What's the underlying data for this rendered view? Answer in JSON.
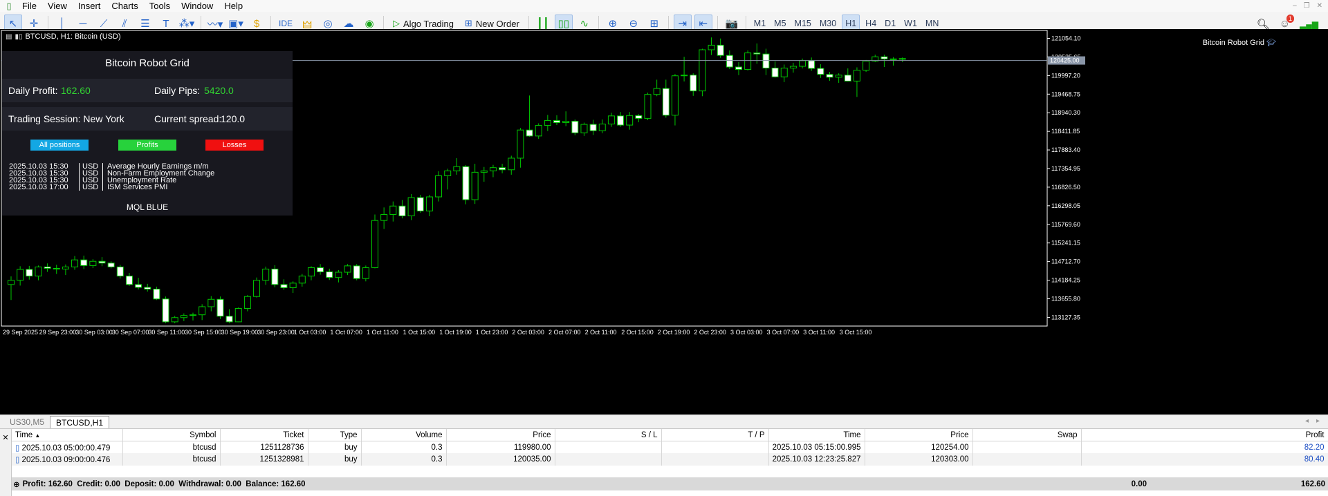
{
  "menu": [
    "File",
    "View",
    "Insert",
    "Charts",
    "Tools",
    "Window",
    "Help"
  ],
  "toolbar": {
    "ide": "IDE",
    "algo_trading": "Algo Trading",
    "new_order": "New Order",
    "timeframes": [
      "M1",
      "M5",
      "M15",
      "M30",
      "H1",
      "H4",
      "D1",
      "W1",
      "MN"
    ],
    "active_timeframe": "H1",
    "notifications_count": "1"
  },
  "chart": {
    "title": "BTCUSD, H1:  Bitcoin (USD)",
    "indicator_name": "Bitcoin Robot Grid",
    "price_tag": "120425.00",
    "colors": {
      "background": "#000000",
      "bull_candle": "#000000",
      "bear_candle": "#ffffff",
      "wick": "#00c800",
      "grid_text": "#ffffff"
    }
  },
  "panel": {
    "title": "Bitcoin Robot Grid",
    "daily_profit_label": "Daily Profit:",
    "daily_profit_value": "162.60",
    "daily_pips_label": "Daily Pips:",
    "daily_pips_value": "5420.0",
    "session_label": "Trading Session: New York",
    "spread_label": "Current spread:",
    "spread_value": "120.0",
    "buttons": {
      "all": "All positions",
      "profits": "Profits",
      "losses": "Losses"
    },
    "news": [
      {
        "time": "2025.10.03 15:30",
        "currency": "USD",
        "event": "Average Hourly Earnings m/m"
      },
      {
        "time": "2025.10.03 15:30",
        "currency": "USD",
        "event": "Non-Farm Employment Change"
      },
      {
        "time": "2025.10.03 15:30",
        "currency": "USD",
        "event": "Unemployment Rate"
      },
      {
        "time": "2025.10.03 17:00",
        "currency": "USD",
        "event": "ISM Services PMI"
      }
    ],
    "brand": "MQL BLUE"
  },
  "chart_data": {
    "type": "candlestick",
    "symbol": "BTCUSD",
    "timeframe": "H1",
    "x_tick_labels": [
      "29 Sep 2025",
      "29 Sep 23:00",
      "30 Sep 03:00",
      "30 Sep 07:00",
      "30 Sep 11:00",
      "30 Sep 15:00",
      "30 Sep 19:00",
      "30 Sep 23:00",
      "1 Oct 03:00",
      "1 Oct 07:00",
      "1 Oct 11:00",
      "1 Oct 15:00",
      "1 Oct 19:00",
      "1 Oct 23:00",
      "2 Oct 03:00",
      "2 Oct 07:00",
      "2 Oct 11:00",
      "2 Oct 15:00",
      "2 Oct 19:00",
      "2 Oct 23:00",
      "3 Oct 03:00",
      "3 Oct 07:00",
      "3 Oct 11:00",
      "3 Oct 15:00"
    ],
    "y_tick_labels": [
      "121054.10",
      "120525.65",
      "119997.20",
      "119468.75",
      "118940.30",
      "118411.85",
      "117883.40",
      "117354.95",
      "116826.50",
      "116298.05",
      "115769.60",
      "115241.15",
      "114712.70",
      "114184.25",
      "113655.80",
      "113127.35"
    ],
    "ylim": [
      112880,
      121280
    ],
    "candles": [
      [
        114060,
        114290,
        113620,
        114180
      ],
      [
        114180,
        114580,
        114030,
        114490
      ],
      [
        114490,
        114590,
        114200,
        114300
      ],
      [
        114300,
        114600,
        114180,
        114560
      ],
      [
        114560,
        114660,
        114420,
        114520
      ],
      [
        114520,
        114620,
        114360,
        114500
      ],
      [
        114500,
        114630,
        114330,
        114560
      ],
      [
        114560,
        114870,
        114480,
        114760
      ],
      [
        114760,
        114880,
        114500,
        114600
      ],
      [
        114600,
        114780,
        114530,
        114720
      ],
      [
        114720,
        114840,
        114580,
        114670
      ],
      [
        114670,
        114720,
        114520,
        114560
      ],
      [
        114560,
        114620,
        114230,
        114300
      ],
      [
        114300,
        114390,
        114020,
        114060
      ],
      [
        114060,
        114250,
        113920,
        113980
      ],
      [
        113980,
        114080,
        113860,
        113930
      ],
      [
        113930,
        114000,
        113620,
        113650
      ],
      [
        113650,
        113720,
        112960,
        113000
      ],
      [
        113000,
        113170,
        112960,
        113120
      ],
      [
        113120,
        113240,
        113020,
        113180
      ],
      [
        113180,
        113260,
        113040,
        113200
      ],
      [
        113200,
        113500,
        113050,
        113430
      ],
      [
        113430,
        113730,
        113300,
        113640
      ],
      [
        113640,
        113720,
        113080,
        113160
      ],
      [
        113160,
        113360,
        112960,
        113000
      ],
      [
        113000,
        113410,
        112990,
        113380
      ],
      [
        113380,
        113760,
        113300,
        113720
      ],
      [
        113720,
        114260,
        113690,
        114180
      ],
      [
        114180,
        114570,
        114050,
        114500
      ],
      [
        114500,
        114610,
        113980,
        114060
      ],
      [
        114060,
        114210,
        113910,
        113970
      ],
      [
        113970,
        114150,
        113820,
        114100
      ],
      [
        114100,
        114360,
        114000,
        114300
      ],
      [
        114300,
        114580,
        114180,
        114540
      ],
      [
        114540,
        114640,
        114340,
        114420
      ],
      [
        114420,
        114510,
        114190,
        114260
      ],
      [
        114260,
        114470,
        114120,
        114410
      ],
      [
        114410,
        114640,
        114330,
        114590
      ],
      [
        114590,
        114640,
        114180,
        114230
      ],
      [
        114230,
        114600,
        114150,
        114540
      ],
      [
        114540,
        116050,
        114520,
        115880
      ],
      [
        115880,
        116250,
        115640,
        116050
      ],
      [
        116050,
        116420,
        115850,
        116290
      ],
      [
        116290,
        116460,
        115940,
        116010
      ],
      [
        116010,
        116630,
        115890,
        116530
      ],
      [
        116530,
        116610,
        116100,
        116150
      ],
      [
        116150,
        116610,
        116000,
        116550
      ],
      [
        116550,
        117280,
        116420,
        117150
      ],
      [
        117150,
        117350,
        116760,
        117290
      ],
      [
        117290,
        117650,
        117180,
        117410
      ],
      [
        117410,
        117450,
        116340,
        116470
      ],
      [
        116470,
        117490,
        116350,
        117250
      ],
      [
        117250,
        117400,
        116980,
        117290
      ],
      [
        117290,
        117460,
        117110,
        117380
      ],
      [
        117380,
        117490,
        117220,
        117320
      ],
      [
        117320,
        117720,
        117180,
        117650
      ],
      [
        117650,
        118510,
        117380,
        118450
      ],
      [
        118450,
        119430,
        118260,
        118280
      ],
      [
        118280,
        118640,
        118200,
        118580
      ],
      [
        118580,
        118880,
        118420,
        118720
      ],
      [
        118720,
        118870,
        118590,
        118660
      ],
      [
        118660,
        118980,
        118560,
        118700
      ],
      [
        118700,
        118750,
        118300,
        118370
      ],
      [
        118370,
        118660,
        118280,
        118610
      ],
      [
        118610,
        118740,
        118310,
        118430
      ],
      [
        118430,
        118750,
        118360,
        118620
      ],
      [
        118620,
        118940,
        118540,
        118850
      ],
      [
        118850,
        118960,
        118540,
        118590
      ],
      [
        118590,
        118960,
        118460,
        118860
      ],
      [
        118860,
        118900,
        118670,
        118780
      ],
      [
        118780,
        119510,
        118730,
        119460
      ],
      [
        119460,
        119880,
        119410,
        119630
      ],
      [
        119630,
        119880,
        118800,
        118870
      ],
      [
        118870,
        120040,
        118580,
        119990
      ],
      [
        119990,
        120530,
        119830,
        120010
      ],
      [
        120010,
        120060,
        119420,
        119560
      ],
      [
        119560,
        120760,
        119410,
        120730
      ],
      [
        120730,
        121080,
        120580,
        120860
      ],
      [
        120860,
        121050,
        120500,
        120570
      ],
      [
        120570,
        120710,
        120180,
        120240
      ],
      [
        120240,
        120380,
        120010,
        120170
      ],
      [
        120170,
        120710,
        120140,
        120640
      ],
      [
        120640,
        120910,
        120330,
        120610
      ],
      [
        120610,
        120760,
        120010,
        120210
      ],
      [
        120210,
        120400,
        119940,
        119960
      ],
      [
        119960,
        120310,
        119810,
        120210
      ],
      [
        120210,
        120360,
        120080,
        120260
      ],
      [
        120260,
        120480,
        120200,
        120420
      ],
      [
        120420,
        120510,
        120130,
        120200
      ],
      [
        120200,
        120320,
        119930,
        120030
      ],
      [
        120030,
        120100,
        119850,
        119950
      ],
      [
        119950,
        120060,
        119790,
        120010
      ],
      [
        120010,
        120200,
        119830,
        119840
      ],
      [
        119840,
        120230,
        119390,
        120150
      ],
      [
        120150,
        120440,
        120100,
        120410
      ],
      [
        120410,
        120590,
        120380,
        120530
      ],
      [
        120530,
        120590,
        120240,
        120470
      ],
      [
        120470,
        120520,
        120280,
        120460
      ],
      [
        120460,
        120510,
        120380,
        120480
      ]
    ]
  },
  "chart_tabs": [
    "US30,M5",
    "BTCUSD,H1"
  ],
  "trades": {
    "columns": [
      "Time",
      "Symbol",
      "Ticket",
      "Type",
      "Volume",
      "Price",
      "S / L",
      "T / P",
      "Time",
      "Price",
      "Swap",
      "Profit"
    ],
    "rows": [
      [
        "2025.10.03 05:00:00.479",
        "btcusd",
        "1251128736",
        "buy",
        "0.3",
        "119980.00",
        "",
        "",
        "2025.10.03 05:15:00.995",
        "120254.00",
        "",
        "82.20"
      ],
      [
        "2025.10.03 09:00:00.476",
        "btcusd",
        "1251328981",
        "buy",
        "0.3",
        "120035.00",
        "",
        "",
        "2025.10.03 12:23:25.827",
        "120303.00",
        "",
        "80.40"
      ]
    ],
    "summary": "Profit: 162.60  Credit: 0.00  Deposit: 0.00  Withdrawal: 0.00  Balance: 162.60",
    "summary_swap": "0.00",
    "summary_profit": "162.60"
  }
}
